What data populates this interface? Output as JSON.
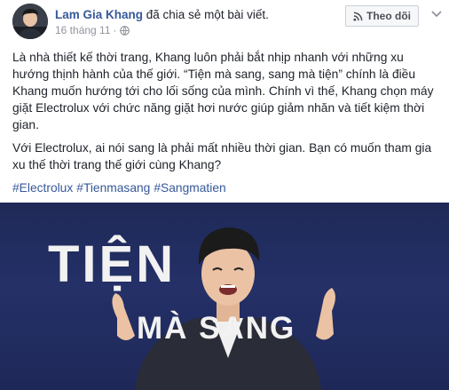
{
  "post": {
    "author": "Lam Gia Khang",
    "action": "đã chia sẻ một bài viết.",
    "date": "16 tháng 11",
    "date_separator": "·",
    "follow_label": "Theo dõi",
    "paragraphs": [
      "Là nhà thiết kế thời trang, Khang luôn phải bắt nhịp nhanh với những xu hướng thịnh hành của thế giới. “Tiện mà sang, sang mà tiện” chính là điều Khang muốn hướng tới cho lối sống của mình. Chính vì thế, Khang chọn máy giặt Electrolux với chức năng giặt hơi nước giúp giảm nhăn và tiết kiệm thời gian.",
      "Với Electrolux, ai nói sang là phải mất nhiều thời gian. Bạn có muốn tham gia xu thế thời trang thế giới cùng Khang?"
    ],
    "hashtags": [
      "#Electrolux",
      "#Tienmasang",
      "#Sangmatien"
    ]
  },
  "media": {
    "title_line_1": "TIỆN",
    "title_line_2": "MÀ SANG",
    "background_color": "#223062"
  },
  "icons": {
    "globe": "globe-icon",
    "rss": "rss-icon",
    "more": "chevron-down-icon"
  }
}
